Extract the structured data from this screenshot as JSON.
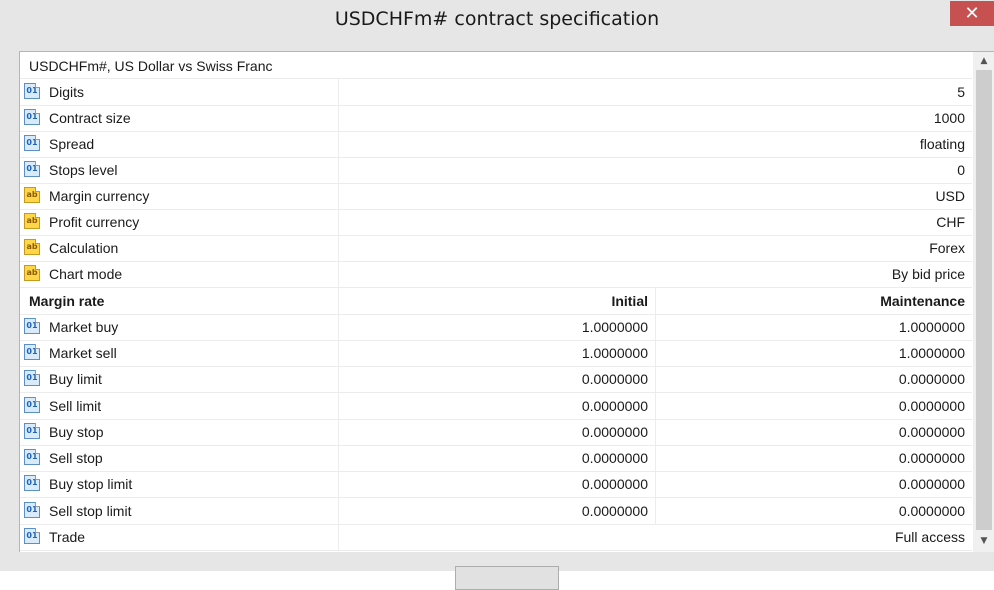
{
  "window": {
    "title": "USDCHFm# contract specification",
    "close_label": "✕"
  },
  "header": {
    "text": "USDCHFm#, US Dollar vs Swiss Franc"
  },
  "properties": [
    {
      "label": "Digits",
      "value": "5",
      "icon": "number-icon"
    },
    {
      "label": "Contract size",
      "value": "1000",
      "icon": "number-icon"
    },
    {
      "label": "Spread",
      "value": "floating",
      "icon": "number-icon"
    },
    {
      "label": "Stops level",
      "value": "0",
      "icon": "number-icon"
    },
    {
      "label": "Margin currency",
      "value": "USD",
      "icon": "string-icon"
    },
    {
      "label": "Profit currency",
      "value": "CHF",
      "icon": "string-icon"
    },
    {
      "label": "Calculation",
      "value": "Forex",
      "icon": "string-icon"
    },
    {
      "label": "Chart mode",
      "value": "By bid price",
      "icon": "string-icon"
    }
  ],
  "margin": {
    "title": "Margin rate",
    "col_initial": "Initial",
    "col_maintenance": "Maintenance",
    "rows": [
      {
        "label": "Market buy",
        "initial": "1.0000000",
        "maintenance": "1.0000000"
      },
      {
        "label": "Market sell",
        "initial": "1.0000000",
        "maintenance": "1.0000000"
      },
      {
        "label": "Buy limit",
        "initial": "0.0000000",
        "maintenance": "0.0000000"
      },
      {
        "label": "Sell limit",
        "initial": "0.0000000",
        "maintenance": "0.0000000"
      },
      {
        "label": "Buy stop",
        "initial": "0.0000000",
        "maintenance": "0.0000000"
      },
      {
        "label": "Sell stop",
        "initial": "0.0000000",
        "maintenance": "0.0000000"
      },
      {
        "label": "Buy stop limit",
        "initial": "0.0000000",
        "maintenance": "0.0000000"
      },
      {
        "label": "Sell stop limit",
        "initial": "0.0000000",
        "maintenance": "0.0000000"
      }
    ]
  },
  "trade": {
    "label": "Trade",
    "value": "Full access"
  },
  "icons": {
    "number_glyph": "01",
    "string_glyph": "ab"
  },
  "scroll": {
    "up": "▲",
    "down": "▼"
  }
}
